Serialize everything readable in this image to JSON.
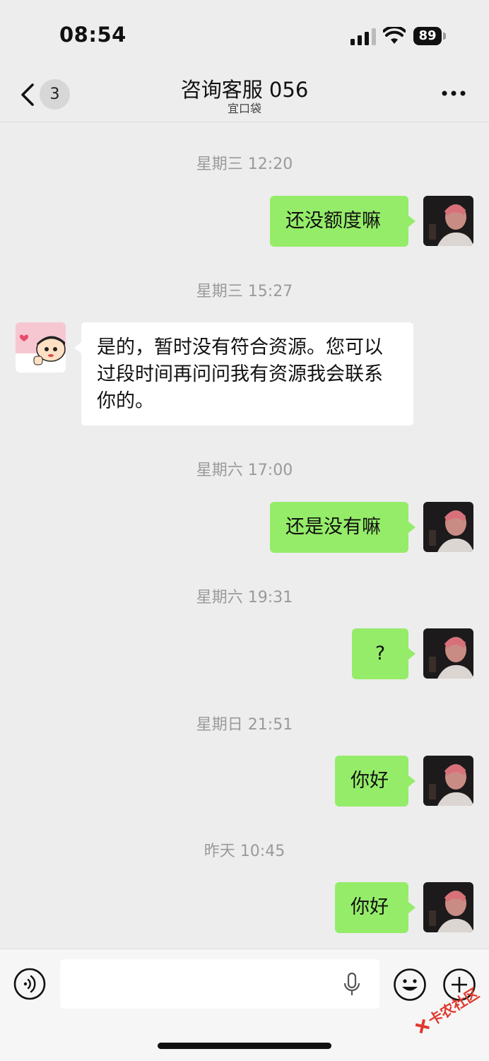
{
  "status_bar": {
    "time": "08:54",
    "battery": "89"
  },
  "nav": {
    "unread_count": "3",
    "title": "咨询客服 056",
    "subtitle": "宜口袋"
  },
  "messages": [
    {
      "timestamp": "星期三 12:20",
      "sender": "me",
      "text": "还没额度嘛"
    },
    {
      "timestamp": "星期三 15:27",
      "sender": "other",
      "text": "是的，暂时没有符合资源。您可以过段时间再问问我有资源我会联系你的。"
    },
    {
      "timestamp": "星期六 17:00",
      "sender": "me",
      "text": "还是没有嘛"
    },
    {
      "timestamp": "星期六 19:31",
      "sender": "me",
      "text": "?"
    },
    {
      "timestamp": "星期日 21:51",
      "sender": "me",
      "text": "你好"
    },
    {
      "timestamp": "昨天 10:45",
      "sender": "me",
      "text": "你好"
    }
  ],
  "watermark": "卡农社区",
  "colors": {
    "outgoing_bubble": "#95ec69",
    "incoming_bubble": "#ffffff",
    "background": "#ededed"
  }
}
